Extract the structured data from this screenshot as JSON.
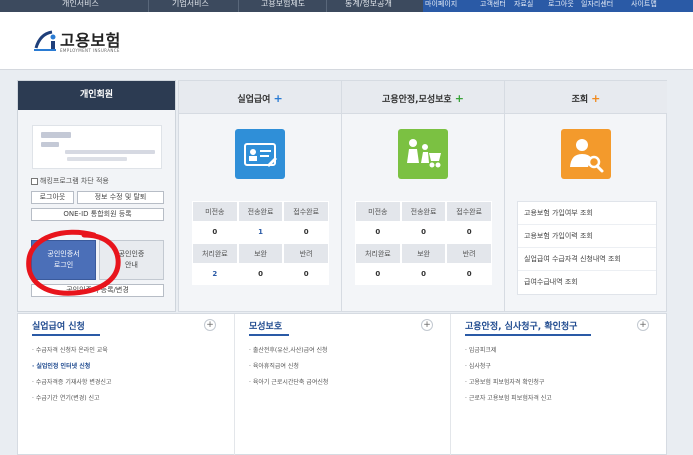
{
  "topnav": {
    "items": [
      "개인서비스",
      "기업서비스",
      "고용보험제도",
      "통계/정보공개"
    ],
    "mypage": "마이페이지",
    "links": [
      "고객센터",
      "사이트맵",
      "로그아웃",
      "일자리센터",
      "자료실"
    ]
  },
  "header": {
    "logo_text": "고용보험",
    "logo_sub": "EMPLOYMENT INSURANCE"
  },
  "login": {
    "title": "개인회원",
    "block_label": "해킹프로그램 차단 적용",
    "btn_login": "로그아웃",
    "btn_edit": "정보 수정 및 탈퇴",
    "btn_oneid": "ONE-ID 통합회원 등록",
    "cert_login_line1": "공인인증서",
    "cert_login_line2": "로그인",
    "cert_guide_line1": "공인인증",
    "cert_guide_line2": "안내",
    "cert_register": "공인인증서 등록/변경"
  },
  "columns": [
    {
      "title": "실업급여",
      "plus_color": "#2a7bd3",
      "icon": "id-card-icon",
      "icon_color": "#2f8fd8",
      "headers1": [
        "미전송",
        "전송완료",
        "접수완료"
      ],
      "values1": [
        "0",
        "1",
        "0"
      ],
      "headers2": [
        "처리완료",
        "보완",
        "반려"
      ],
      "values2": [
        "2",
        "0",
        "0"
      ]
    },
    {
      "title": "고용안정,모성보호",
      "plus_color": "#3aa33a",
      "icon": "family-stroller-icon",
      "icon_color": "#7bc142",
      "headers1": [
        "미전송",
        "전송완료",
        "접수완료"
      ],
      "values1": [
        "0",
        "0",
        "0"
      ],
      "headers2": [
        "처리완료",
        "보완",
        "반려"
      ],
      "values2": [
        "0",
        "0",
        "0"
      ]
    },
    {
      "title": "조회",
      "plus_color": "#f08a1d",
      "icon": "person-search-icon",
      "icon_color": "#f39a2c",
      "items": [
        "고용보험 가입여부 조회",
        "고용보험 가입이력 조회",
        "실업급여 수급자격 신청내역 조회",
        "급여수급내역 조회"
      ]
    }
  ],
  "bottom": [
    {
      "title": "실업급여 신청",
      "items": [
        "수급자격 신청자 온라인 교육",
        "실업인정 인터넷 신청",
        "수급자격증 기재사항 변경신고",
        "수급기간 연기(변경) 신고"
      ]
    },
    {
      "title": "모성보호",
      "items": [
        "출산전후(유산,사산)급여 신청",
        "육아휴직급여 신청",
        "육아기 근로시간단축 급여신청"
      ]
    },
    {
      "title": "고용안정, 심사청구, 확인청구",
      "items": [
        "임금피크제",
        "심사청구",
        "고용보험 피보험자격 확인청구",
        "근로자 고용보험 피보험자격 신고"
      ]
    }
  ]
}
